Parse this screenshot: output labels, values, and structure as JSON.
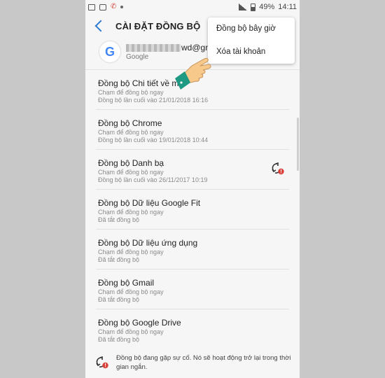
{
  "status_bar": {
    "battery": "49%",
    "time": "14:11"
  },
  "header": {
    "title": "CÀI ĐẶT ĐỒNG BỘ"
  },
  "account": {
    "email_visible": "wd@gma",
    "provider": "Google",
    "logo_letter": "G"
  },
  "menu": {
    "items": [
      {
        "label": "Đồng bộ bây giờ"
      },
      {
        "label": "Xóa tài khoản"
      }
    ]
  },
  "sync_items": [
    {
      "name": "Đồng bộ Chi tiết về mọi",
      "sub1": "Chạm để đồng bộ ngay",
      "sub2": "Đồng bộ lần cuối vào 21/01/2018  16:16",
      "error_icon": false
    },
    {
      "name": "Đồng bộ Chrome",
      "sub1": "Chạm để đồng bộ ngay",
      "sub2": "Đồng bộ lần cuối vào 19/01/2018  10:44",
      "error_icon": false
    },
    {
      "name": "Đồng bộ Danh bạ",
      "sub1": "Chạm để đồng bộ ngay",
      "sub2": "Đồng bộ lần cuối vào 26/11/2017  10:19",
      "error_icon": true
    },
    {
      "name": "Đồng bộ Dữ liệu Google Fit",
      "sub1": "Chạm để đồng bộ ngay",
      "sub2": "Đã tắt đồng bộ",
      "error_icon": false
    },
    {
      "name": "Đồng bộ Dữ liệu ứng dụng",
      "sub1": "Chạm để đồng bộ ngay",
      "sub2": "Đã tắt đồng bộ",
      "error_icon": false
    },
    {
      "name": "Đồng bộ Gmail",
      "sub1": "Chạm để đồng bộ ngay",
      "sub2": "Đã tắt đồng bộ",
      "error_icon": false
    },
    {
      "name": "Đồng bộ Google Drive",
      "sub1": "Chạm để đồng bộ ngay",
      "sub2": "Đã tắt đồng bộ",
      "error_icon": false
    }
  ],
  "footer": {
    "text": "Đồng bộ đang gặp sự cố. Nó sẽ hoạt động trở lại trong thời gian ngắn."
  },
  "colors": {
    "accent": "#2c7bd1",
    "error": "#d9413a",
    "hand": "#f7c98b",
    "cuff": "#1f9a82"
  }
}
